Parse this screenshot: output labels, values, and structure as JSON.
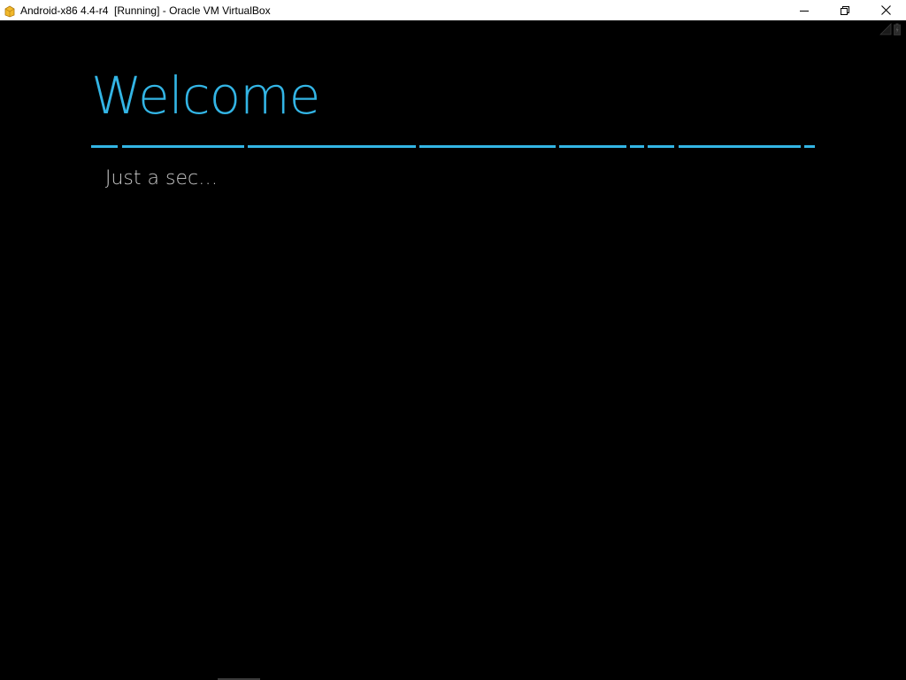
{
  "window": {
    "title": "Android-x86 4.4-r4  [Running] - Oracle VM VirtualBox",
    "controls": [
      "minimize",
      "restore",
      "close"
    ]
  },
  "status_bar": {
    "icons": [
      "signal-icon",
      "battery-icon"
    ]
  },
  "setup": {
    "heading": "Welcome",
    "message": "Just a sec…"
  },
  "colors": {
    "accent": "#33b5e5",
    "background": "#000000",
    "text_secondary": "#c8c8c8"
  }
}
